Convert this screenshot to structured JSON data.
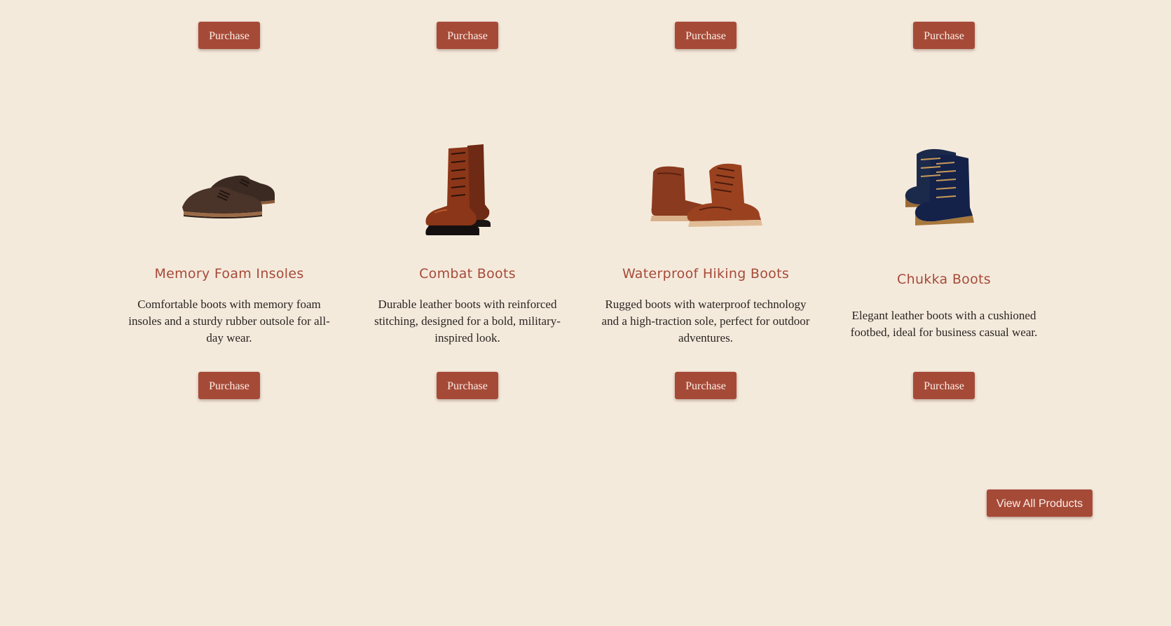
{
  "top_row": {
    "purchase_labels": [
      "Purchase",
      "Purchase",
      "Purchase",
      "Purchase"
    ]
  },
  "products": [
    {
      "title": "Memory Foam Insoles",
      "description": "Comfortable boots with memory foam insoles and a sturdy rubber outsole for all-day wear.",
      "purchase_label": "Purchase",
      "image_icon": "brown-suede-brogue-shoes-image"
    },
    {
      "title": "Combat Boots",
      "description": "Durable leather boots with reinforced stitching, designed for a bold, military-inspired look.",
      "purchase_label": "Purchase",
      "image_icon": "brown-leather-combat-boots-image"
    },
    {
      "title": "Waterproof Hiking Boots",
      "description": "Rugged boots with waterproof technology and a high-traction sole, perfect for outdoor adventures.",
      "purchase_label": "Purchase",
      "image_icon": "brown-moc-toe-hiking-boots-image"
    },
    {
      "title": "Chukka Boots",
      "description": "Elegant leather boots with a cushioned footbed, ideal for business casual wear.",
      "purchase_label": "Purchase",
      "image_icon": "navy-suede-lace-up-boots-image"
    }
  ],
  "view_all_label": "View All Products",
  "colors": {
    "background": "#f4eadc",
    "accent": "#a64a38",
    "button_text": "#fbeee6",
    "body_text": "#2a2522"
  }
}
